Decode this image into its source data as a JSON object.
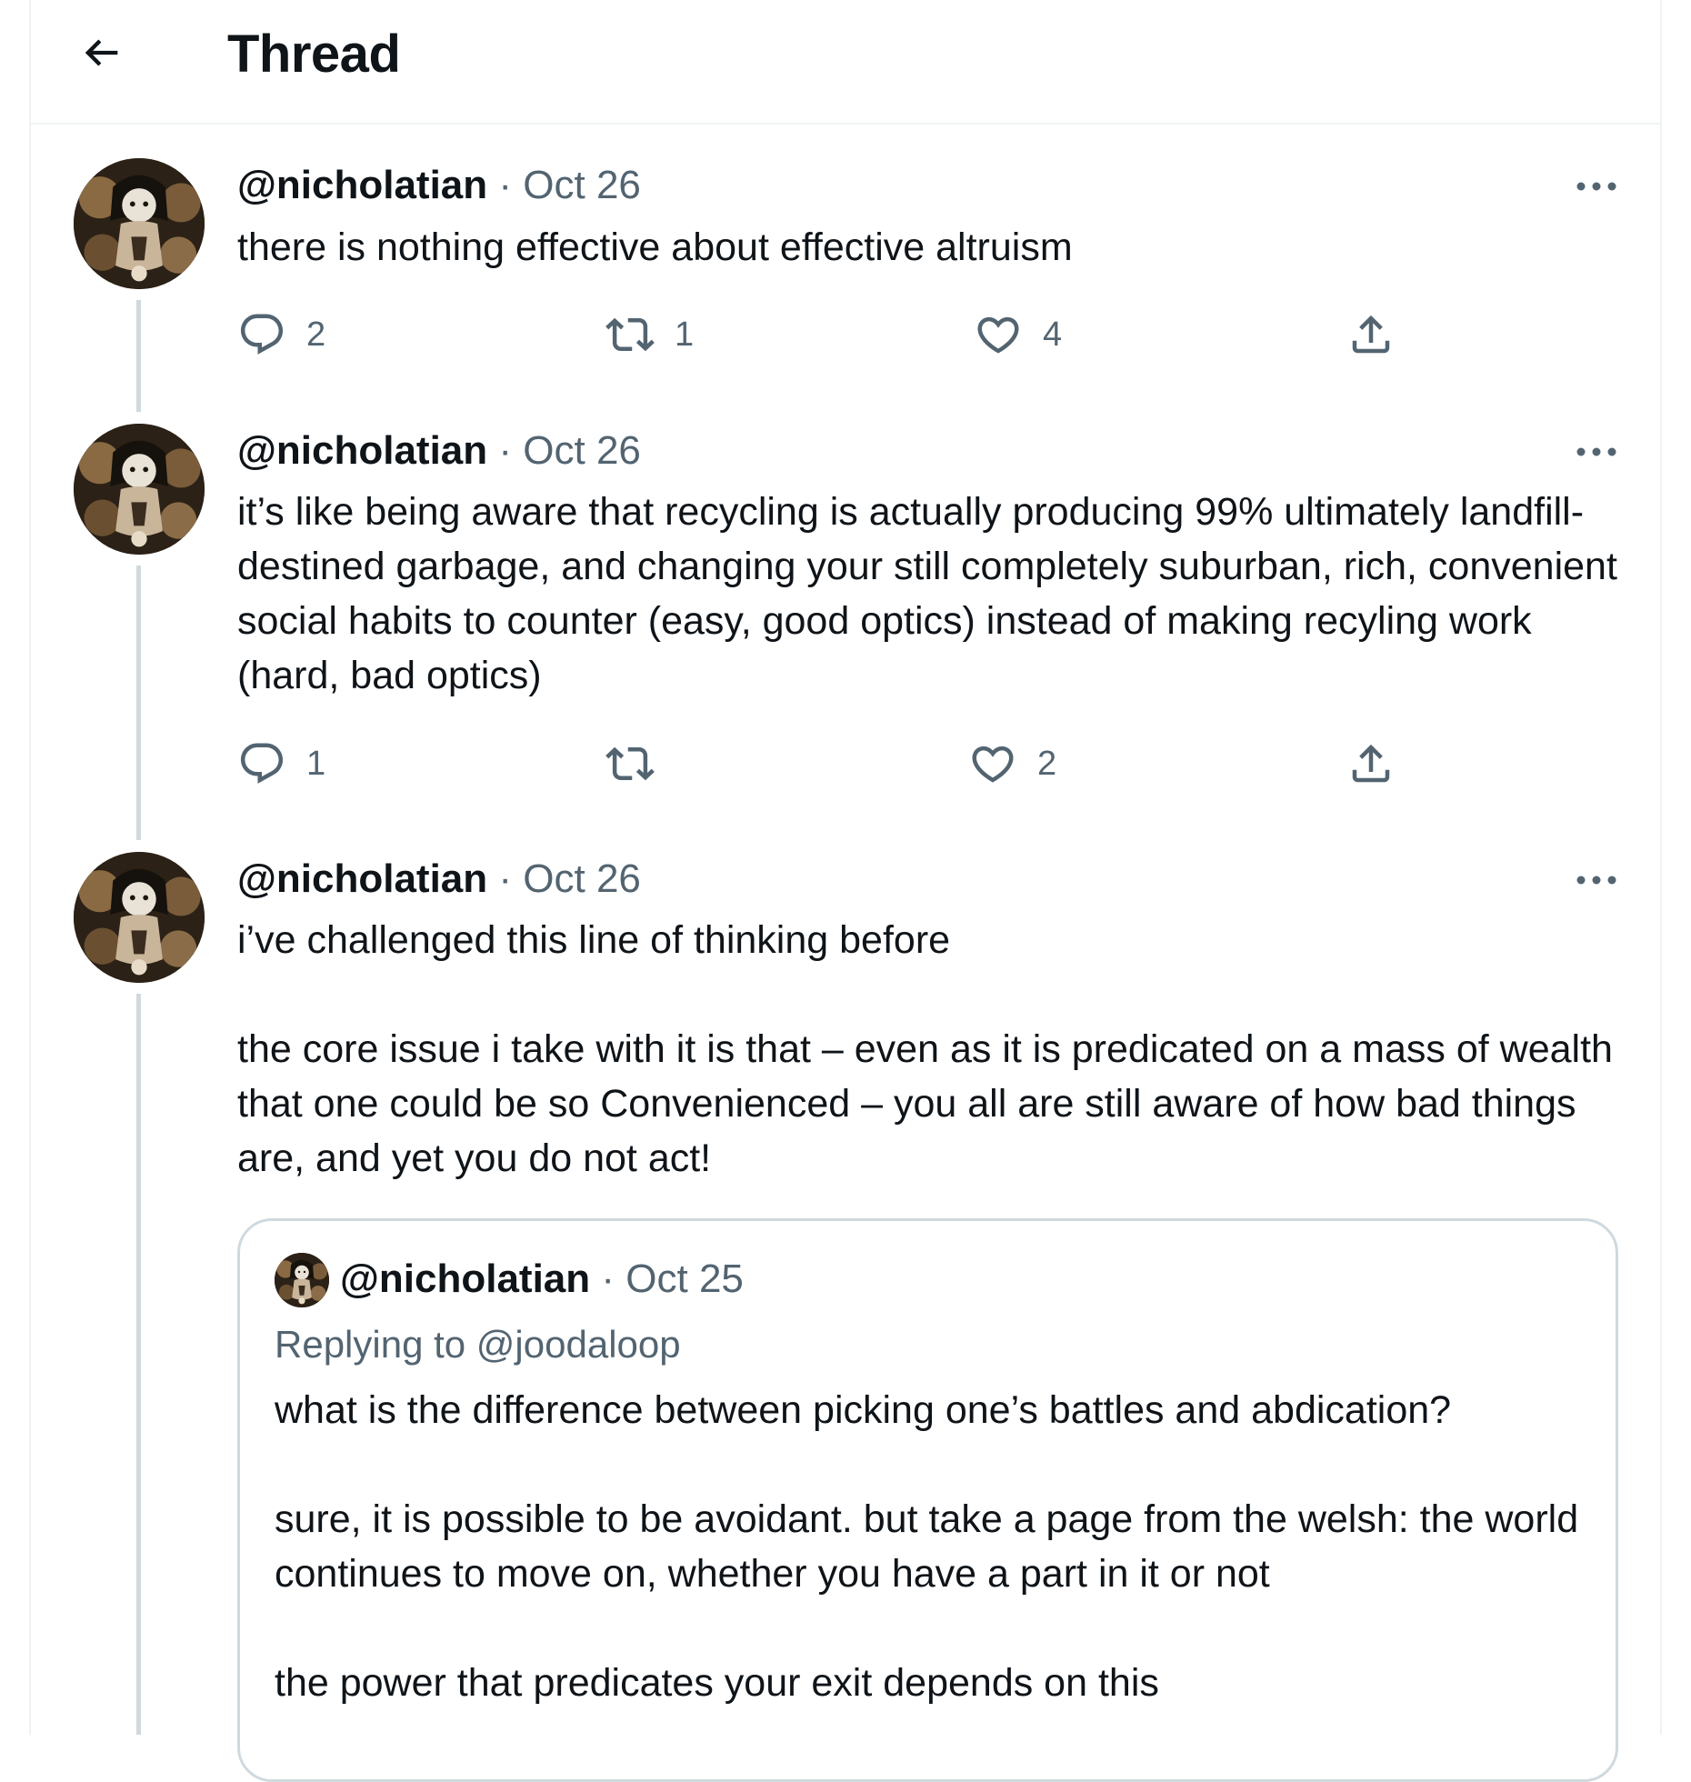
{
  "header": {
    "title": "Thread",
    "back_icon": "arrow-left-icon"
  },
  "colors": {
    "text": "#0f1419",
    "secondary": "#536471",
    "border": "#cfd9de",
    "divider": "#eff3f4"
  },
  "tweets": [
    {
      "handle": "@nicholatian",
      "separator": "·",
      "date": "Oct 26",
      "text": "there is nothing effective about effective altruism",
      "replies": "2",
      "retweets": "1",
      "likes": "4"
    },
    {
      "handle": "@nicholatian",
      "separator": "·",
      "date": "Oct 26",
      "text": "it’s like being aware that recycling is actually producing 99% ultimately landfill-destined garbage, and changing your still completely suburban, rich, convenient social habits to counter (easy, good optics) instead of making recyling work (hard, bad optics)",
      "replies": "1",
      "retweets": "",
      "likes": "2"
    },
    {
      "handle": "@nicholatian",
      "separator": "·",
      "date": "Oct 26",
      "text": "i’ve challenged this line of thinking before\n\nthe core issue i take with it is that – even as it is predicated on a mass of wealth that one could be so Convenienced – you all are still aware of how bad things are, and yet you do not act!",
      "quote": {
        "handle": "@nicholatian",
        "separator": "·",
        "date": "Oct 25",
        "replying_prefix": "Replying to",
        "replying_to": "@joodaloop",
        "text": "what is the difference between picking one’s battles and abdication?\n\nsure, it is possible to be avoidant. but take a page from the welsh: the world continues to move on, whether you have a part in it or not\n\nthe power that predicates your exit depends on this"
      }
    }
  ]
}
